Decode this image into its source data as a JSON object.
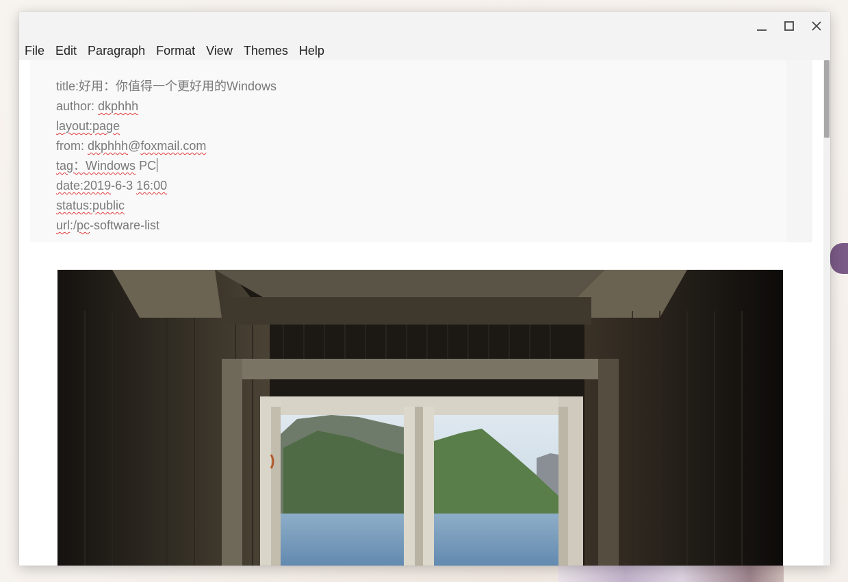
{
  "window": {
    "controls": {
      "minimize_icon": "minimize-icon",
      "maximize_icon": "maximize-icon",
      "close_icon": "close-icon"
    }
  },
  "menu": {
    "items": [
      "File",
      "Edit",
      "Paragraph",
      "Format",
      "View",
      "Themes",
      "Help"
    ]
  },
  "frontmatter": {
    "title": {
      "key": "title:",
      "value": "好用：你值得一个更好用的Windows"
    },
    "author": {
      "key": "author: ",
      "value": "dkphhh"
    },
    "layout": {
      "text": "layout:page"
    },
    "from": {
      "key": "from: ",
      "value_local": "dkphhh",
      "value_at": "@",
      "value_domain": "foxmail.com"
    },
    "tag": {
      "key": "tag：",
      "value_a": "Windows",
      "value_b": " PC"
    },
    "date": {
      "date_part": "date:2019",
      "date_rest": "-6-3 ",
      "time": "16:00"
    },
    "status": {
      "text": "status:public"
    },
    "url": {
      "a": "url",
      "b": ":/",
      "c": "pc",
      "d": "-software-list"
    }
  },
  "colors": {
    "accent_squiggle": "#e03c3c",
    "text": "#7a7a7a"
  }
}
